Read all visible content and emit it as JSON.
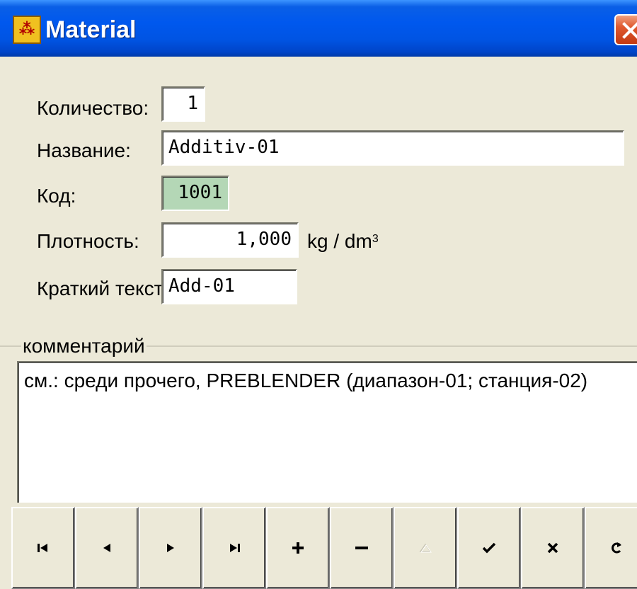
{
  "window": {
    "title": "Material",
    "icon": "app-logo-icon",
    "close": "close-icon"
  },
  "form": {
    "quantity": {
      "label": "Количество:",
      "value": "1"
    },
    "name": {
      "label": "Название:",
      "value": "Additiv-01"
    },
    "code": {
      "label": "Код:",
      "value": "1001"
    },
    "density": {
      "label": "Плотность:",
      "value": "1,000",
      "unit": "kg / dm",
      "unit_sup": "3"
    },
    "short_text": {
      "label": "Краткий текст:",
      "value": "Add-01"
    }
  },
  "comment": {
    "legend": "комментарий",
    "text": "см.: среди прочего, PREBLENDER (диапазон-01; станция-02)"
  },
  "toolbar": {
    "buttons": [
      {
        "icon": "first-record-icon",
        "enabled": true
      },
      {
        "icon": "prev-record-icon",
        "enabled": true
      },
      {
        "icon": "next-record-icon",
        "enabled": true
      },
      {
        "icon": "last-record-icon",
        "enabled": true
      },
      {
        "icon": "insert-record-icon",
        "enabled": true
      },
      {
        "icon": "delete-record-icon",
        "enabled": true
      },
      {
        "icon": "edit-record-icon",
        "enabled": false
      },
      {
        "icon": "post-record-icon",
        "enabled": true
      },
      {
        "icon": "cancel-edit-icon",
        "enabled": true
      },
      {
        "icon": "refresh-icon",
        "enabled": true
      }
    ]
  },
  "colors": {
    "titlebar": "#0054e3",
    "window_bg": "#ece9d8",
    "code_field_bg": "#b4d7b6",
    "close_button": "#e05a30"
  }
}
